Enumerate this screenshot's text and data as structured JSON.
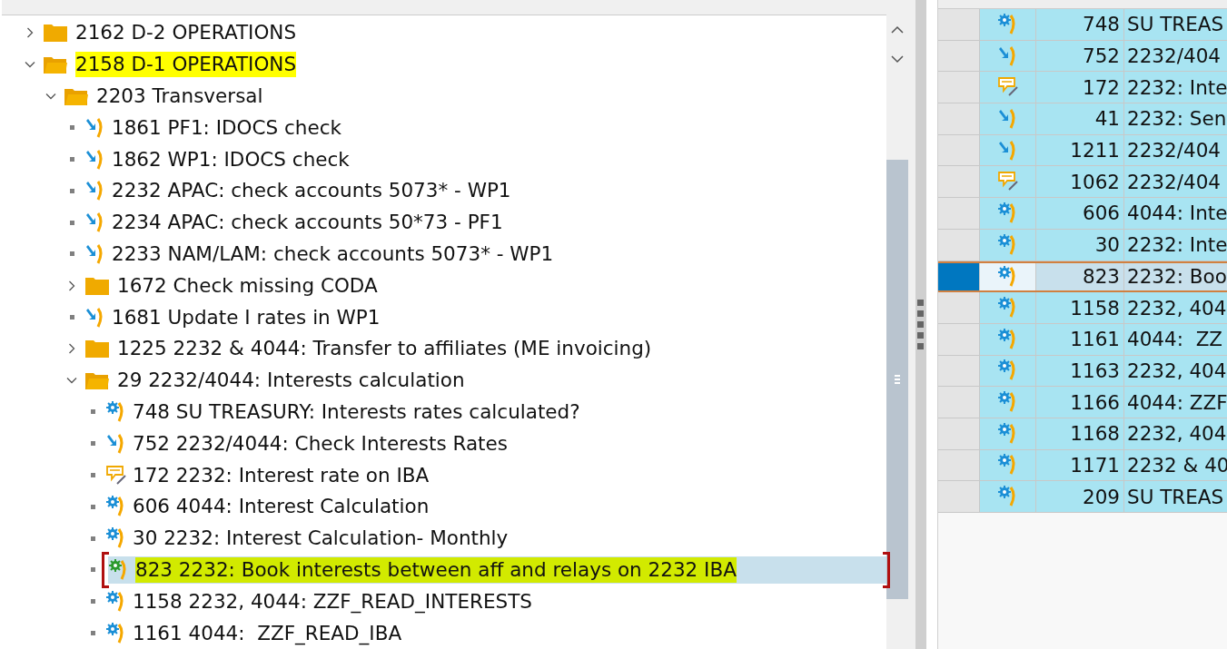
{
  "tree": [
    {
      "kind": "folder",
      "label": "2162 D-2 OPERATIONS",
      "expanded": false,
      "highlighted": false,
      "selected": false
    },
    {
      "kind": "folder",
      "label": "2158 D-1 OPERATIONS",
      "expanded": true,
      "highlighted": true,
      "selected": false,
      "children": [
        {
          "kind": "folder",
          "label": "2203 Transversal",
          "expanded": true,
          "highlighted": false,
          "selected": false,
          "children": [
            {
              "kind": "step",
              "label": "1861 PF1: IDOCS check",
              "highlighted": false,
              "selected": false
            },
            {
              "kind": "step",
              "label": "1862 WP1: IDOCS check",
              "highlighted": false,
              "selected": false
            },
            {
              "kind": "step",
              "label": "2232 APAC: check accounts 5073* - WP1",
              "highlighted": false,
              "selected": false
            },
            {
              "kind": "step",
              "label": "2234 APAC: check accounts 50*73 - PF1",
              "highlighted": false,
              "selected": false
            },
            {
              "kind": "step",
              "label": "2233 NAM/LAM: check accounts 5073* - WP1",
              "highlighted": false,
              "selected": false
            },
            {
              "kind": "folder",
              "label": "1672 Check missing CODA",
              "expanded": false,
              "highlighted": false,
              "selected": false
            },
            {
              "kind": "step",
              "label": "1681 Update I rates in WP1",
              "highlighted": false,
              "selected": false
            },
            {
              "kind": "folder",
              "label": "1225 2232 & 4044: Transfer to affiliates (ME invoicing)",
              "expanded": false,
              "highlighted": false,
              "selected": false
            },
            {
              "kind": "folder",
              "label": "29 2232/4044: Interests calculation",
              "expanded": true,
              "highlighted": false,
              "selected": false,
              "children": [
                {
                  "kind": "gear",
                  "label": "748 SU TREASURY: Interests rates calculated?",
                  "highlighted": false,
                  "selected": false
                },
                {
                  "kind": "step",
                  "label": "752 2232/4044: Check Interests Rates",
                  "highlighted": false,
                  "selected": false
                },
                {
                  "kind": "note",
                  "label": "172 2232: Interest rate on IBA",
                  "highlighted": false,
                  "selected": false
                },
                {
                  "kind": "gear",
                  "label": "606 4044: Interest Calculation",
                  "highlighted": false,
                  "selected": false
                },
                {
                  "kind": "gear",
                  "label": "30 2232: Interest Calculation- Monthly",
                  "highlighted": false,
                  "selected": false
                },
                {
                  "kind": "gear",
                  "label": "823 2232: Book interests between aff and relays on 2232 IBA",
                  "highlighted": true,
                  "selected": true
                },
                {
                  "kind": "gear",
                  "label": "1158 2232, 4044: ZZF_READ_INTERESTS",
                  "highlighted": false,
                  "selected": false
                },
                {
                  "kind": "gear",
                  "label": "1161 4044:  ZZF_READ_IBA",
                  "highlighted": false,
                  "selected": false
                }
              ]
            }
          ]
        }
      ]
    }
  ],
  "table": {
    "rows": [
      {
        "kind": "gear",
        "number": "748",
        "text": "SU TREAS",
        "selected": false
      },
      {
        "kind": "step",
        "number": "752",
        "text": "2232/404",
        "selected": false
      },
      {
        "kind": "note",
        "number": "172",
        "text": "2232: Inte",
        "selected": false
      },
      {
        "kind": "step",
        "number": "41",
        "text": "2232: Sen",
        "selected": false
      },
      {
        "kind": "step",
        "number": "1211",
        "text": "2232/404",
        "selected": false
      },
      {
        "kind": "note",
        "number": "1062",
        "text": "2232/404",
        "selected": false
      },
      {
        "kind": "gear",
        "number": "606",
        "text": "4044: Inte",
        "selected": false
      },
      {
        "kind": "gear",
        "number": "30",
        "text": "2232: Inte",
        "selected": false
      },
      {
        "kind": "gear",
        "number": "823",
        "text": "2232: Boo",
        "selected": true
      },
      {
        "kind": "gear",
        "number": "1158",
        "text": "2232, 404",
        "selected": false
      },
      {
        "kind": "gear",
        "number": "1161",
        "text": "4044:  ZZ",
        "selected": false
      },
      {
        "kind": "gear",
        "number": "1163",
        "text": "2232, 404",
        "selected": false
      },
      {
        "kind": "gear",
        "number": "1166",
        "text": "4044: ZZF",
        "selected": false
      },
      {
        "kind": "gear",
        "number": "1168",
        "text": "2232, 404",
        "selected": false
      },
      {
        "kind": "gear",
        "number": "1171",
        "text": "2232 & 40",
        "selected": false
      },
      {
        "kind": "gear",
        "number": "209",
        "text": "SU TREAS",
        "selected": false
      }
    ]
  }
}
